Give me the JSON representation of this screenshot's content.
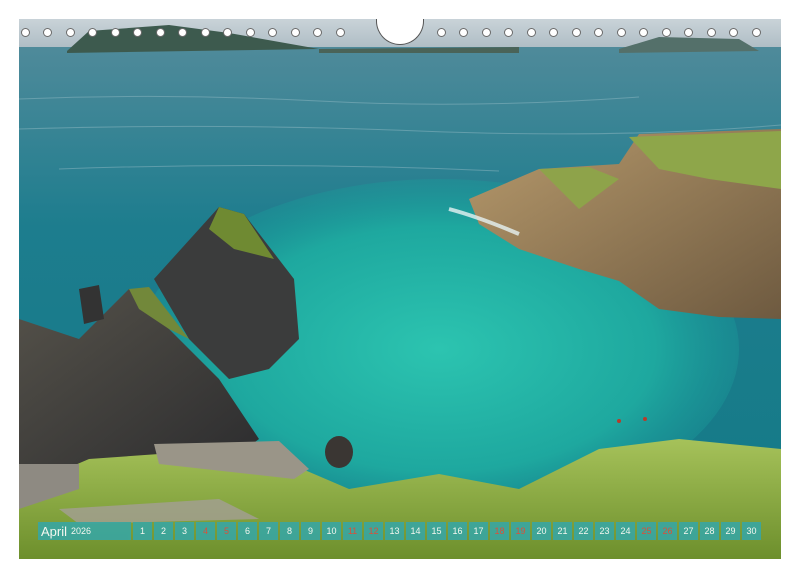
{
  "calendar": {
    "month": "April",
    "year": "2026",
    "days": [
      {
        "n": "1",
        "weekend": false
      },
      {
        "n": "2",
        "weekend": false
      },
      {
        "n": "3",
        "weekend": false
      },
      {
        "n": "4",
        "weekend": true
      },
      {
        "n": "5",
        "weekend": true
      },
      {
        "n": "6",
        "weekend": false
      },
      {
        "n": "7",
        "weekend": false
      },
      {
        "n": "8",
        "weekend": false
      },
      {
        "n": "9",
        "weekend": false
      },
      {
        "n": "10",
        "weekend": false
      },
      {
        "n": "11",
        "weekend": true
      },
      {
        "n": "12",
        "weekend": true
      },
      {
        "n": "13",
        "weekend": false
      },
      {
        "n": "14",
        "weekend": false
      },
      {
        "n": "15",
        "weekend": false
      },
      {
        "n": "16",
        "weekend": false
      },
      {
        "n": "17",
        "weekend": false
      },
      {
        "n": "18",
        "weekend": true
      },
      {
        "n": "19",
        "weekend": true
      },
      {
        "n": "20",
        "weekend": false
      },
      {
        "n": "21",
        "weekend": false
      },
      {
        "n": "22",
        "weekend": false
      },
      {
        "n": "23",
        "weekend": false
      },
      {
        "n": "24",
        "weekend": false
      },
      {
        "n": "25",
        "weekend": true
      },
      {
        "n": "26",
        "weekend": true
      },
      {
        "n": "27",
        "weekend": false
      },
      {
        "n": "28",
        "weekend": false
      },
      {
        "n": "29",
        "weekend": false
      },
      {
        "n": "30",
        "weekend": false
      }
    ],
    "colors": {
      "strip": "#3aa6a0",
      "weekend": "#e24b3c",
      "sea": "#1f8f96",
      "lagoon": "#21b4a4",
      "grass": "#7ea63a"
    }
  }
}
